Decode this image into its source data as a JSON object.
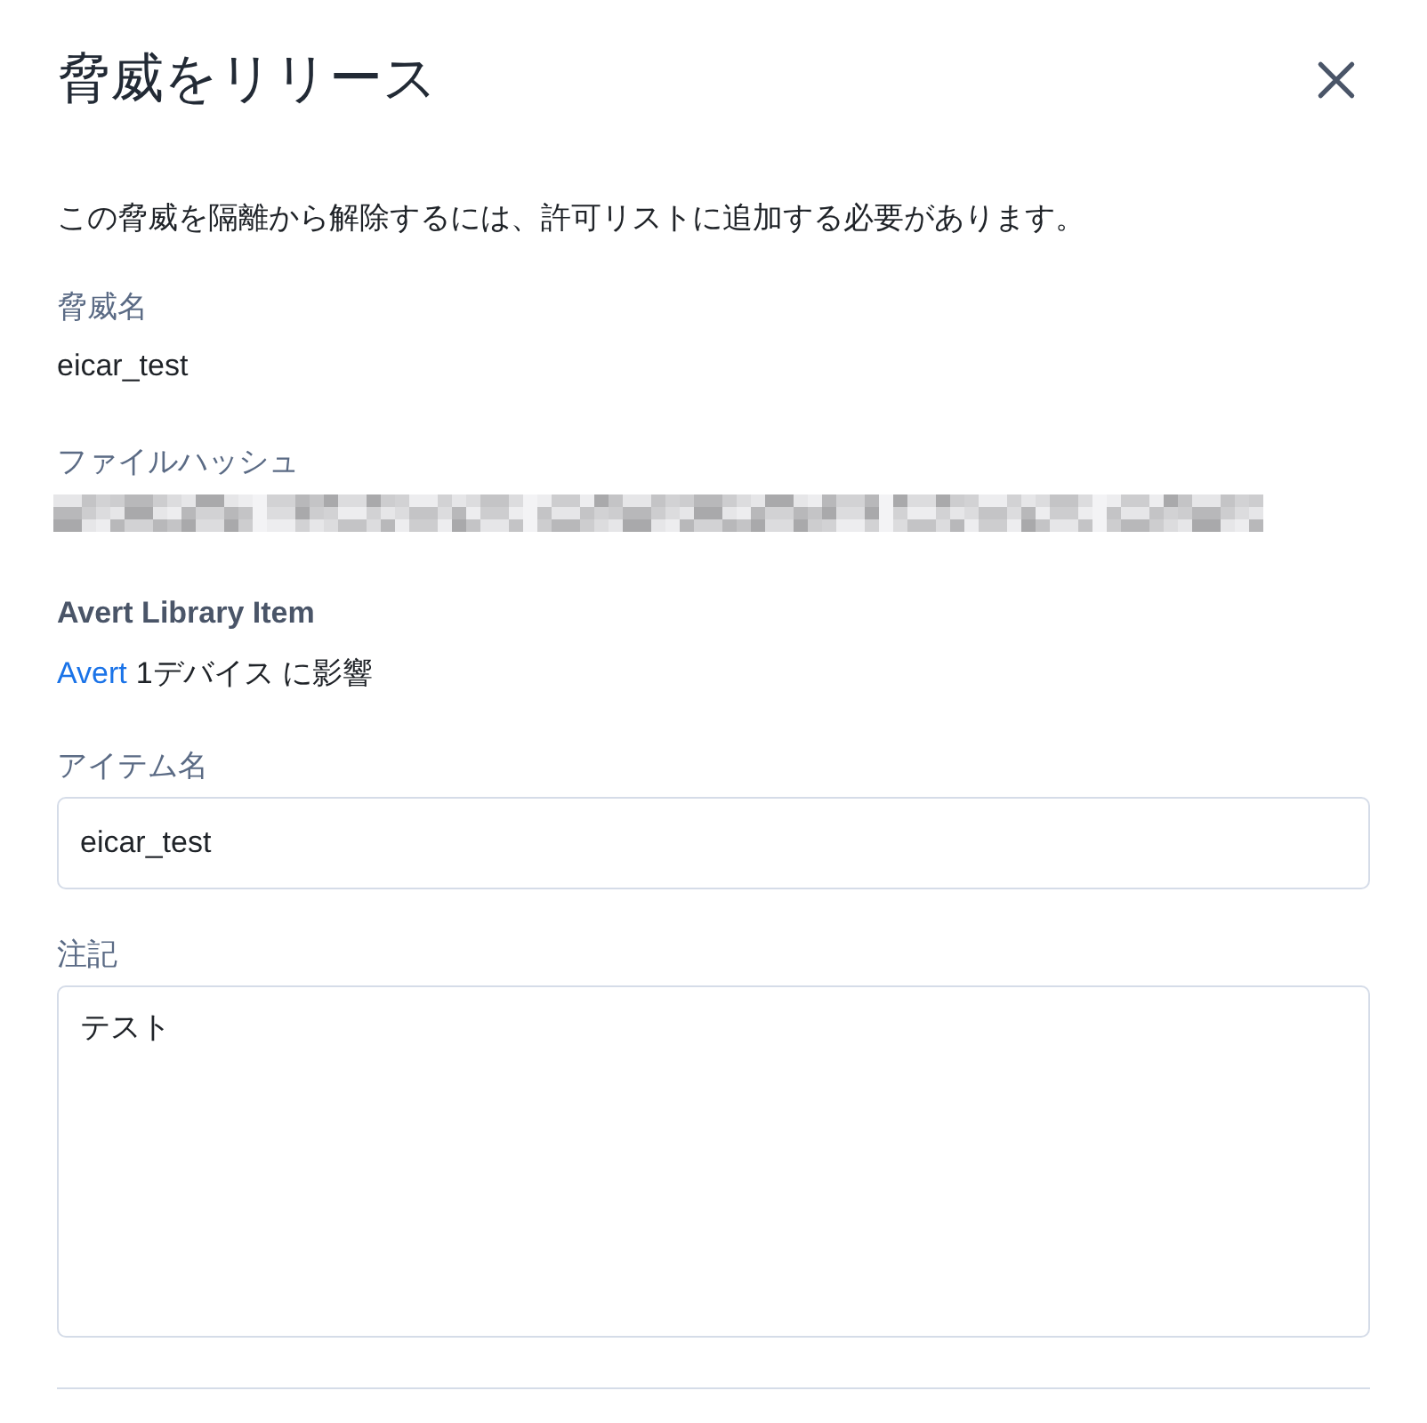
{
  "dialog": {
    "title": "脅威をリリース",
    "description": "この脅威を隔離から解除するには、許可リストに追加する必要があります。",
    "details": [
      {
        "kind": "text",
        "label": "脅威名",
        "value": "eicar_test"
      },
      {
        "kind": "redacted",
        "label": "ファイルハッシュ"
      }
    ],
    "library": {
      "heading": "Avert Library Item",
      "link": "Avert",
      "affected": "1デバイス に影響"
    },
    "item_name": {
      "label": "アイテム名",
      "value": "eicar_test"
    },
    "notes": {
      "label": "注記",
      "value": "テスト"
    }
  }
}
